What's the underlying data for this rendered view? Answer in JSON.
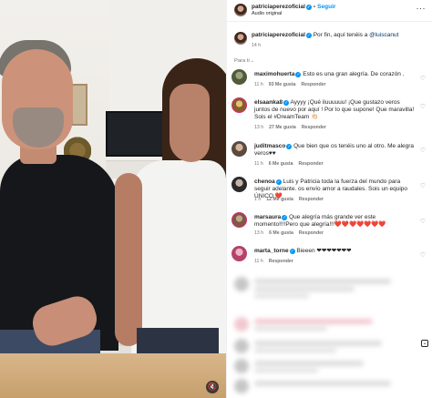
{
  "header": {
    "username": "patriciaperezoficial",
    "follow_label": "Seguir",
    "audio_label": "Audio original",
    "more_icon": "more-horizontal-icon"
  },
  "caption": {
    "username": "patriciaperezoficial",
    "text_before": "Por fin, aquí tenéis a ",
    "mention": "@luiscanut",
    "time": "14 h"
  },
  "section_label": "Para ti",
  "comments": [
    {
      "username": "maximohuerta",
      "verified": true,
      "text": "Esto es una gran alegría. De corazón .",
      "meta": [
        "11 h",
        "93 Me gusta",
        "Responder"
      ]
    },
    {
      "username": "elsaanka8",
      "verified": true,
      "text": "Ayyyy ¡Qué iluuuuuu! ¡Que gustazo veros juntos de nuevo por aquí ! Por lo que supone! Que maravilla! Sois el #DreamTeam 👏🏻",
      "meta": [
        "13 h",
        "27 Me gusta",
        "Responder"
      ]
    },
    {
      "username": "juditmasco",
      "verified": true,
      "text": "Que bien que os tenéis uno al otro. Me alegra veros♥♥",
      "meta": [
        "11 h",
        "6 Me gusta",
        "Responder"
      ]
    },
    {
      "username": "chenoa",
      "verified": true,
      "text": "Luis y Patricia toda la fuerza del mundo para seguir adelante. os envío amor a raudales. Sois un equipo ÚNICO.❤️",
      "meta": [
        "1 h",
        "12 Me gusta",
        "Responder"
      ]
    },
    {
      "username": "marsaura",
      "verified": true,
      "text": "Que alegría más grande ver este momento!!!!Pero que alegría!!!❤️❤️❤️❤️❤️❤️❤️",
      "meta": [
        "13 h",
        "6 Me gusta",
        "Responder"
      ]
    },
    {
      "username": "marta_torne",
      "verified": true,
      "text": "Bieeen ❤❤❤❤❤❤❤",
      "meta": [
        "11 h",
        "Responder"
      ]
    }
  ],
  "icons": {
    "verified": "verified-badge-icon",
    "heart": "heart-outline-icon",
    "mute": "speaker-muted-icon"
  },
  "colors": {
    "accent": "#0095f6",
    "mention": "#00376b",
    "muted_text": "#737373"
  }
}
